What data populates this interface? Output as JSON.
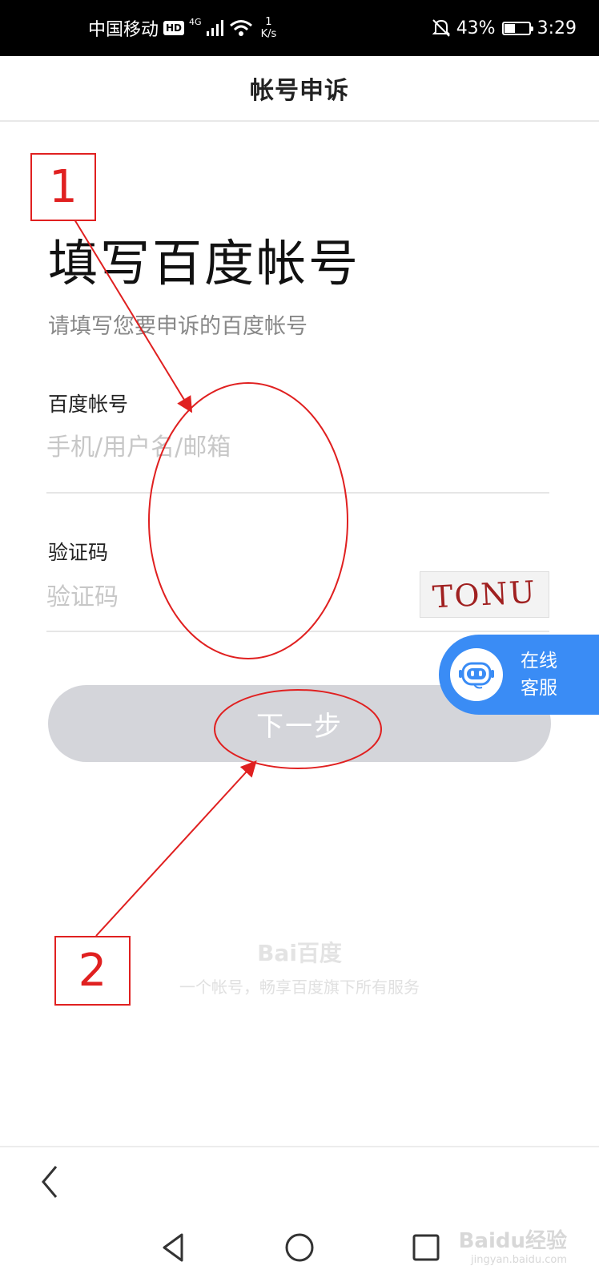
{
  "status_bar": {
    "carrier": "中国移动",
    "hd_badge": "HD",
    "network_type": "4G",
    "net_speed_value": "1",
    "net_speed_unit": "K/s",
    "battery_percent": "43%",
    "battery_level": 0.43,
    "time": "3:29"
  },
  "header": {
    "title": "帐号申诉"
  },
  "page": {
    "heading": "填写百度帐号",
    "subtitle": "请填写您要申诉的百度帐号"
  },
  "form": {
    "account": {
      "label": "百度帐号",
      "placeholder": "手机/用户名/邮箱",
      "value": ""
    },
    "captcha": {
      "label": "验证码",
      "placeholder": "验证码",
      "value": "",
      "image_text": "TONU"
    },
    "next_button": "下一步"
  },
  "service": {
    "label_line1": "在线",
    "label_line2": "客服"
  },
  "footer": {
    "brand_logo": "Bai百度",
    "slogan": "一个帐号，畅享百度旗下所有服务"
  },
  "watermark": {
    "logo": "Baidu经验",
    "url": "jingyan.baidu.com"
  },
  "annotations": {
    "marker_1": "1",
    "marker_2": "2",
    "color": "#e02020"
  },
  "colors": {
    "service_blue": "#3a8cf5",
    "button_disabled": "#d4d5da"
  }
}
